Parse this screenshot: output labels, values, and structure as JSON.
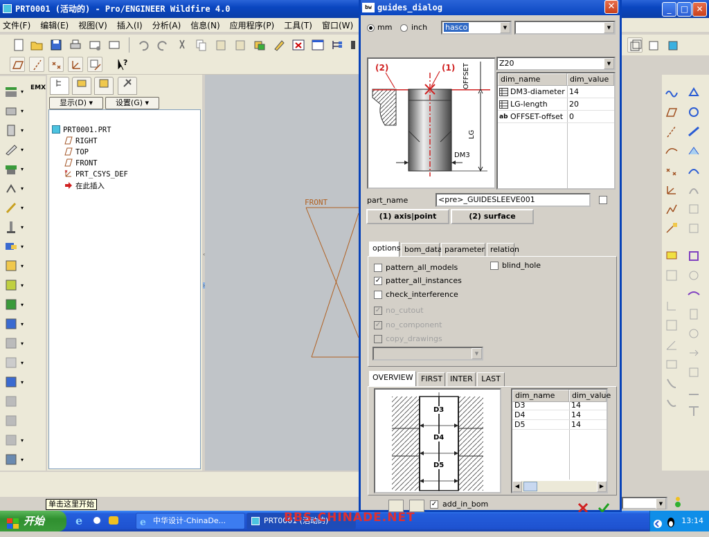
{
  "window": {
    "title": "PRT0001 (活动的) - Pro/ENGINEER Wildfire 4.0",
    "minimize": "_",
    "maximize": "□",
    "close": "✕"
  },
  "menubar": [
    "文件(F)",
    "编辑(E)",
    "视图(V)",
    "插入(I)",
    "分析(A)",
    "信息(N)",
    "应用程序(P)",
    "工具(T)",
    "窗口(W)"
  ],
  "tree": {
    "show_button": "显示(D) ▾",
    "settings_button": "设置(G) ▾",
    "emx_label": "EMX",
    "items": [
      {
        "label": "PRT0001.PRT",
        "icon": "part-icon"
      },
      {
        "label": "RIGHT",
        "icon": "datum-plane-icon"
      },
      {
        "label": "TOP",
        "icon": "datum-plane-icon"
      },
      {
        "label": "FRONT",
        "icon": "datum-plane-icon"
      },
      {
        "label": "PRT_CSYS_DEF",
        "icon": "csys-icon"
      },
      {
        "label": "在此插入",
        "icon": "insert-here-icon"
      }
    ]
  },
  "graphics": {
    "datum_label": "FRONT"
  },
  "status": {
    "tooltip": "单击这里开始"
  },
  "taskbar": {
    "start": "开始",
    "items": [
      "中华设计-ChinaDe...",
      "PRT0001 (活动的)"
    ],
    "watermark": "BBS.CHINADE.NET",
    "clock": "13:14"
  },
  "dialog": {
    "title": "guides_dialog",
    "close": "✕",
    "unit_mm": "mm",
    "unit_inch": "inch",
    "unit_selected": "mm",
    "catalog_value": "hasco",
    "catalog2_value": "",
    "figure": {
      "label_1": "(1)",
      "label_2": "(2)",
      "offset": "OFFSET",
      "lg": "LG",
      "dm3": "DM3"
    },
    "size_value": "Z20",
    "dim_table": {
      "headers": [
        "dim_name",
        "dim_value"
      ],
      "rows": [
        {
          "name": "DM3-diameter",
          "value": "14",
          "icon": "table-icon"
        },
        {
          "name": "LG-length",
          "value": "20",
          "icon": "table-icon"
        },
        {
          "name": "OFFSET-offset",
          "value": "0",
          "icon": "ab-icon"
        }
      ]
    },
    "part_name_label": "part_name",
    "part_name_value": "<pre>_GUIDESLEEVE001",
    "btn_axis": "(1) axis|point",
    "btn_surface": "(2) surface",
    "tabs": [
      "options",
      "bom_data",
      "parameter",
      "relation"
    ],
    "active_tab": "options",
    "options": [
      {
        "label": "pattern_all_models",
        "checked": false,
        "disabled": false
      },
      {
        "label": "patter_all_instances",
        "checked": true,
        "disabled": false
      },
      {
        "label": "check_interference",
        "checked": false,
        "disabled": false
      },
      {
        "label": "no_cutout",
        "checked": true,
        "disabled": true
      },
      {
        "label": "no_component",
        "checked": true,
        "disabled": true
      },
      {
        "label": "copy_drawings",
        "checked": false,
        "disabled": true
      }
    ],
    "blind_hole": {
      "label": "blind_hole",
      "checked": false
    },
    "overview_tabs": [
      "OVERVIEW",
      "FIRST",
      "INTER",
      "LAST"
    ],
    "overview_figure": {
      "d3": "D3",
      "d4": "D4",
      "d5": "D5"
    },
    "overview_table": {
      "headers": [
        "dim_name",
        "dim_value"
      ],
      "rows": [
        {
          "name": "D3",
          "value": "14"
        },
        {
          "name": "D4",
          "value": "14"
        },
        {
          "name": "D5",
          "value": "14"
        }
      ]
    },
    "add_in_bom": {
      "label": "add_in_bom",
      "checked": true
    }
  }
}
